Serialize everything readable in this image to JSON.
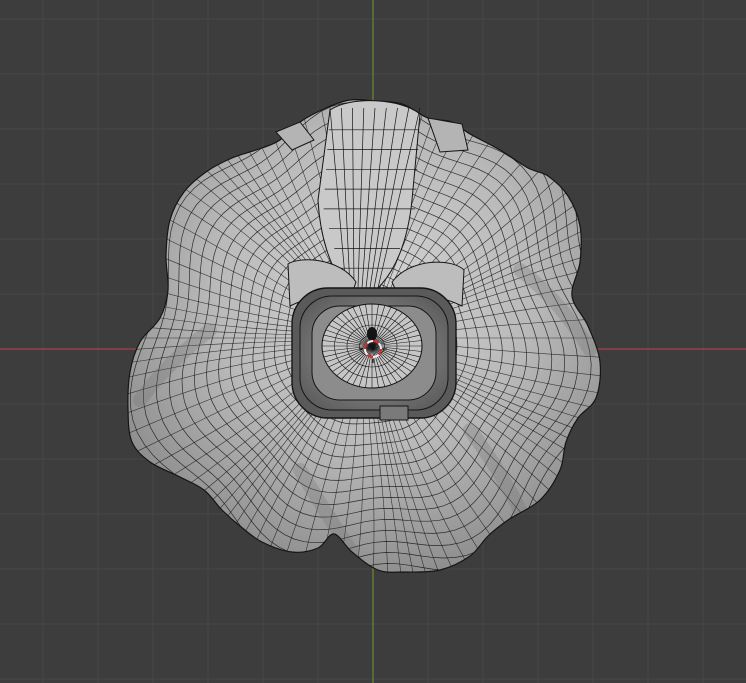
{
  "viewport": {
    "mode": "wireframe-overlay",
    "view": "top-orthographic"
  },
  "theme": {
    "background": "#3d3d3d",
    "grid_line": "#474747",
    "axis_x": "#c0414d",
    "axis_y": "#6f9a2a",
    "mesh_fill_light": "#c6c6c6",
    "mesh_fill_mid": "#a7a7a7",
    "mesh_fill_dark": "#7a7a7a",
    "wire": "#151515",
    "cursor_ring_a": "#d92b2b",
    "cursor_ring_b": "#f2f2f2"
  },
  "icons": {
    "origin": "3d-cursor-icon"
  }
}
